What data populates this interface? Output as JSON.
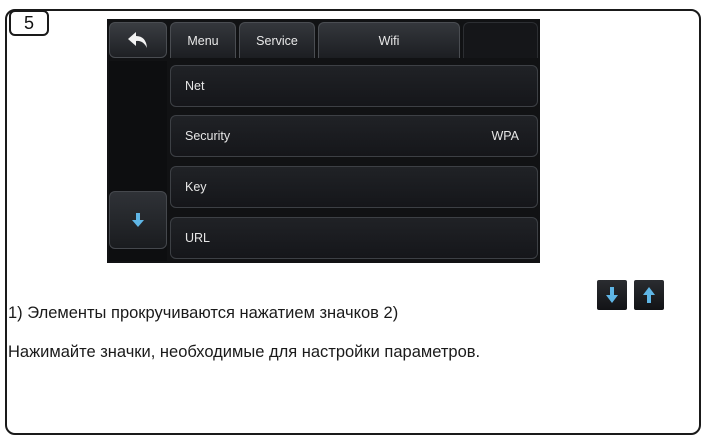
{
  "step_number": "5",
  "screen": {
    "tabs": [
      "Menu",
      "Service",
      "Wifi"
    ],
    "rows": [
      {
        "label": "Net",
        "value": ""
      },
      {
        "label": "Security",
        "value": "WPA"
      },
      {
        "label": "Key",
        "value": ""
      },
      {
        "label": "URL",
        "value": ""
      }
    ]
  },
  "icons": {
    "back": "back-arrow-icon",
    "scroll_down": "arrow-down-icon",
    "key_down": "arrow-down-icon",
    "key_up": "arrow-up-icon",
    "icon_color": "#5fb6e6"
  },
  "caption": {
    "line1": "1) Элементы прокручиваются нажатием значков 2)",
    "line2": "Нажимайте значки, необходимые для настройки параметров."
  }
}
